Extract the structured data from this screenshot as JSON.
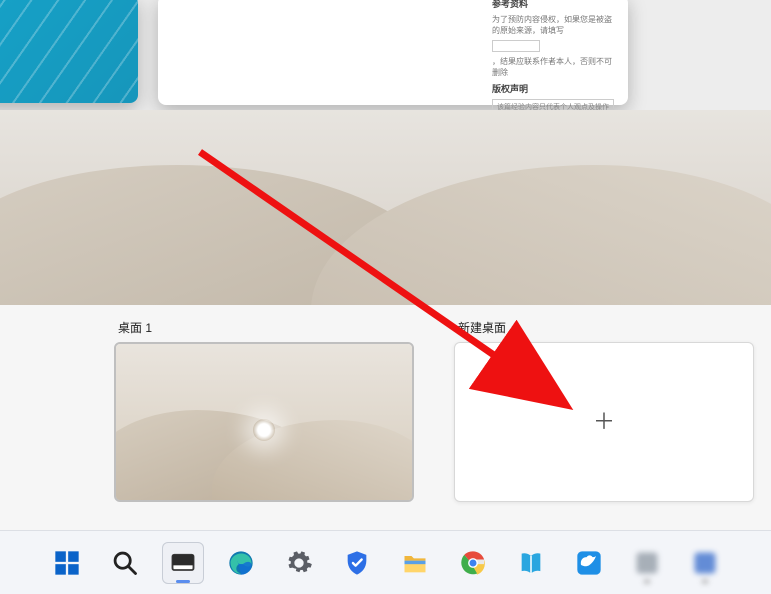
{
  "top_windows": {
    "doc": {
      "heading1": "参考资料",
      "line1_pre": "为了预防内容侵权，如果您是被盗的原始来源，请填写",
      "line1_post": "，结果应联系作者本人，否则不可删除",
      "heading2": "版权声明",
      "box_text": "该篇经验内容只代表个人观点及操作经验仅供参考以及有需要的朋友，请勿在未经授权的情况下转载，如需转载注明出处且须本人。若是对于该篇内容有任何疑问请在评论区留言。当前页面所展示的词条介绍内容均由可通过系统自动生成。"
    }
  },
  "virtual_desktops": {
    "current_label": "桌面 1",
    "new_label": "新建桌面"
  },
  "taskbar": {
    "items": [
      {
        "name": "start",
        "interactable": true
      },
      {
        "name": "search",
        "interactable": true
      },
      {
        "name": "task-view",
        "interactable": true
      },
      {
        "name": "edge",
        "interactable": true
      },
      {
        "name": "settings",
        "interactable": true
      },
      {
        "name": "security",
        "interactable": true
      },
      {
        "name": "file-explorer",
        "interactable": true
      },
      {
        "name": "chrome",
        "interactable": true
      },
      {
        "name": "reader",
        "interactable": true
      },
      {
        "name": "thunder",
        "interactable": true
      },
      {
        "name": "app-a",
        "interactable": true
      },
      {
        "name": "app-b",
        "interactable": true
      }
    ]
  }
}
